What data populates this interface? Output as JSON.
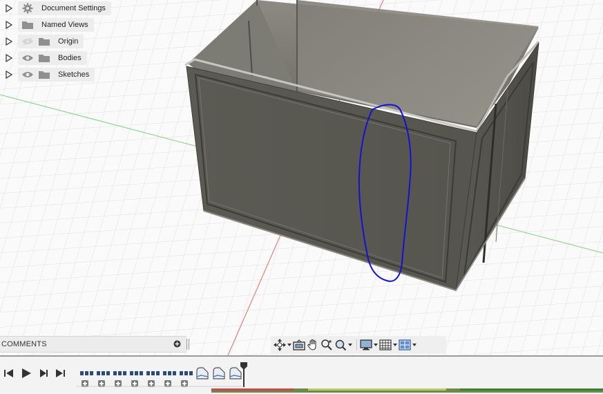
{
  "browser": {
    "items": [
      {
        "label": "Document Settings",
        "icon": "gear-icon",
        "visibility": "none"
      },
      {
        "label": "Named Views",
        "icon": "folder-icon",
        "visibility": "none"
      },
      {
        "label": "Origin",
        "icon": "folder-icon",
        "visibility": "hidden"
      },
      {
        "label": "Bodies",
        "icon": "folder-icon",
        "visibility": "visible"
      },
      {
        "label": "Sketches",
        "icon": "folder-icon",
        "visibility": "visible"
      }
    ]
  },
  "comments": {
    "title": "COMMENTS",
    "add_icon": "plus-circle-icon"
  },
  "nav_toolbar": {
    "tools": [
      "orbit-icon",
      "look-at-icon",
      "pan-icon",
      "zoom-icon",
      "fit-icon",
      "display-settings-icon",
      "grid-icon",
      "viewports-icon"
    ]
  },
  "timeline": {
    "controls": [
      "skip-to-start-icon",
      "play-icon",
      "step-forward-icon",
      "skip-to-end-icon"
    ],
    "feature_count": 7,
    "sketch_count": 3
  },
  "colors": {
    "model_body": "#5f5e57",
    "annotation_stroke": "#1010d8",
    "grid_line": "#d9d9d9",
    "axis_red": "#e06060",
    "axis_green": "#6fce6f",
    "timeline_feature": "#2c4a7a"
  }
}
